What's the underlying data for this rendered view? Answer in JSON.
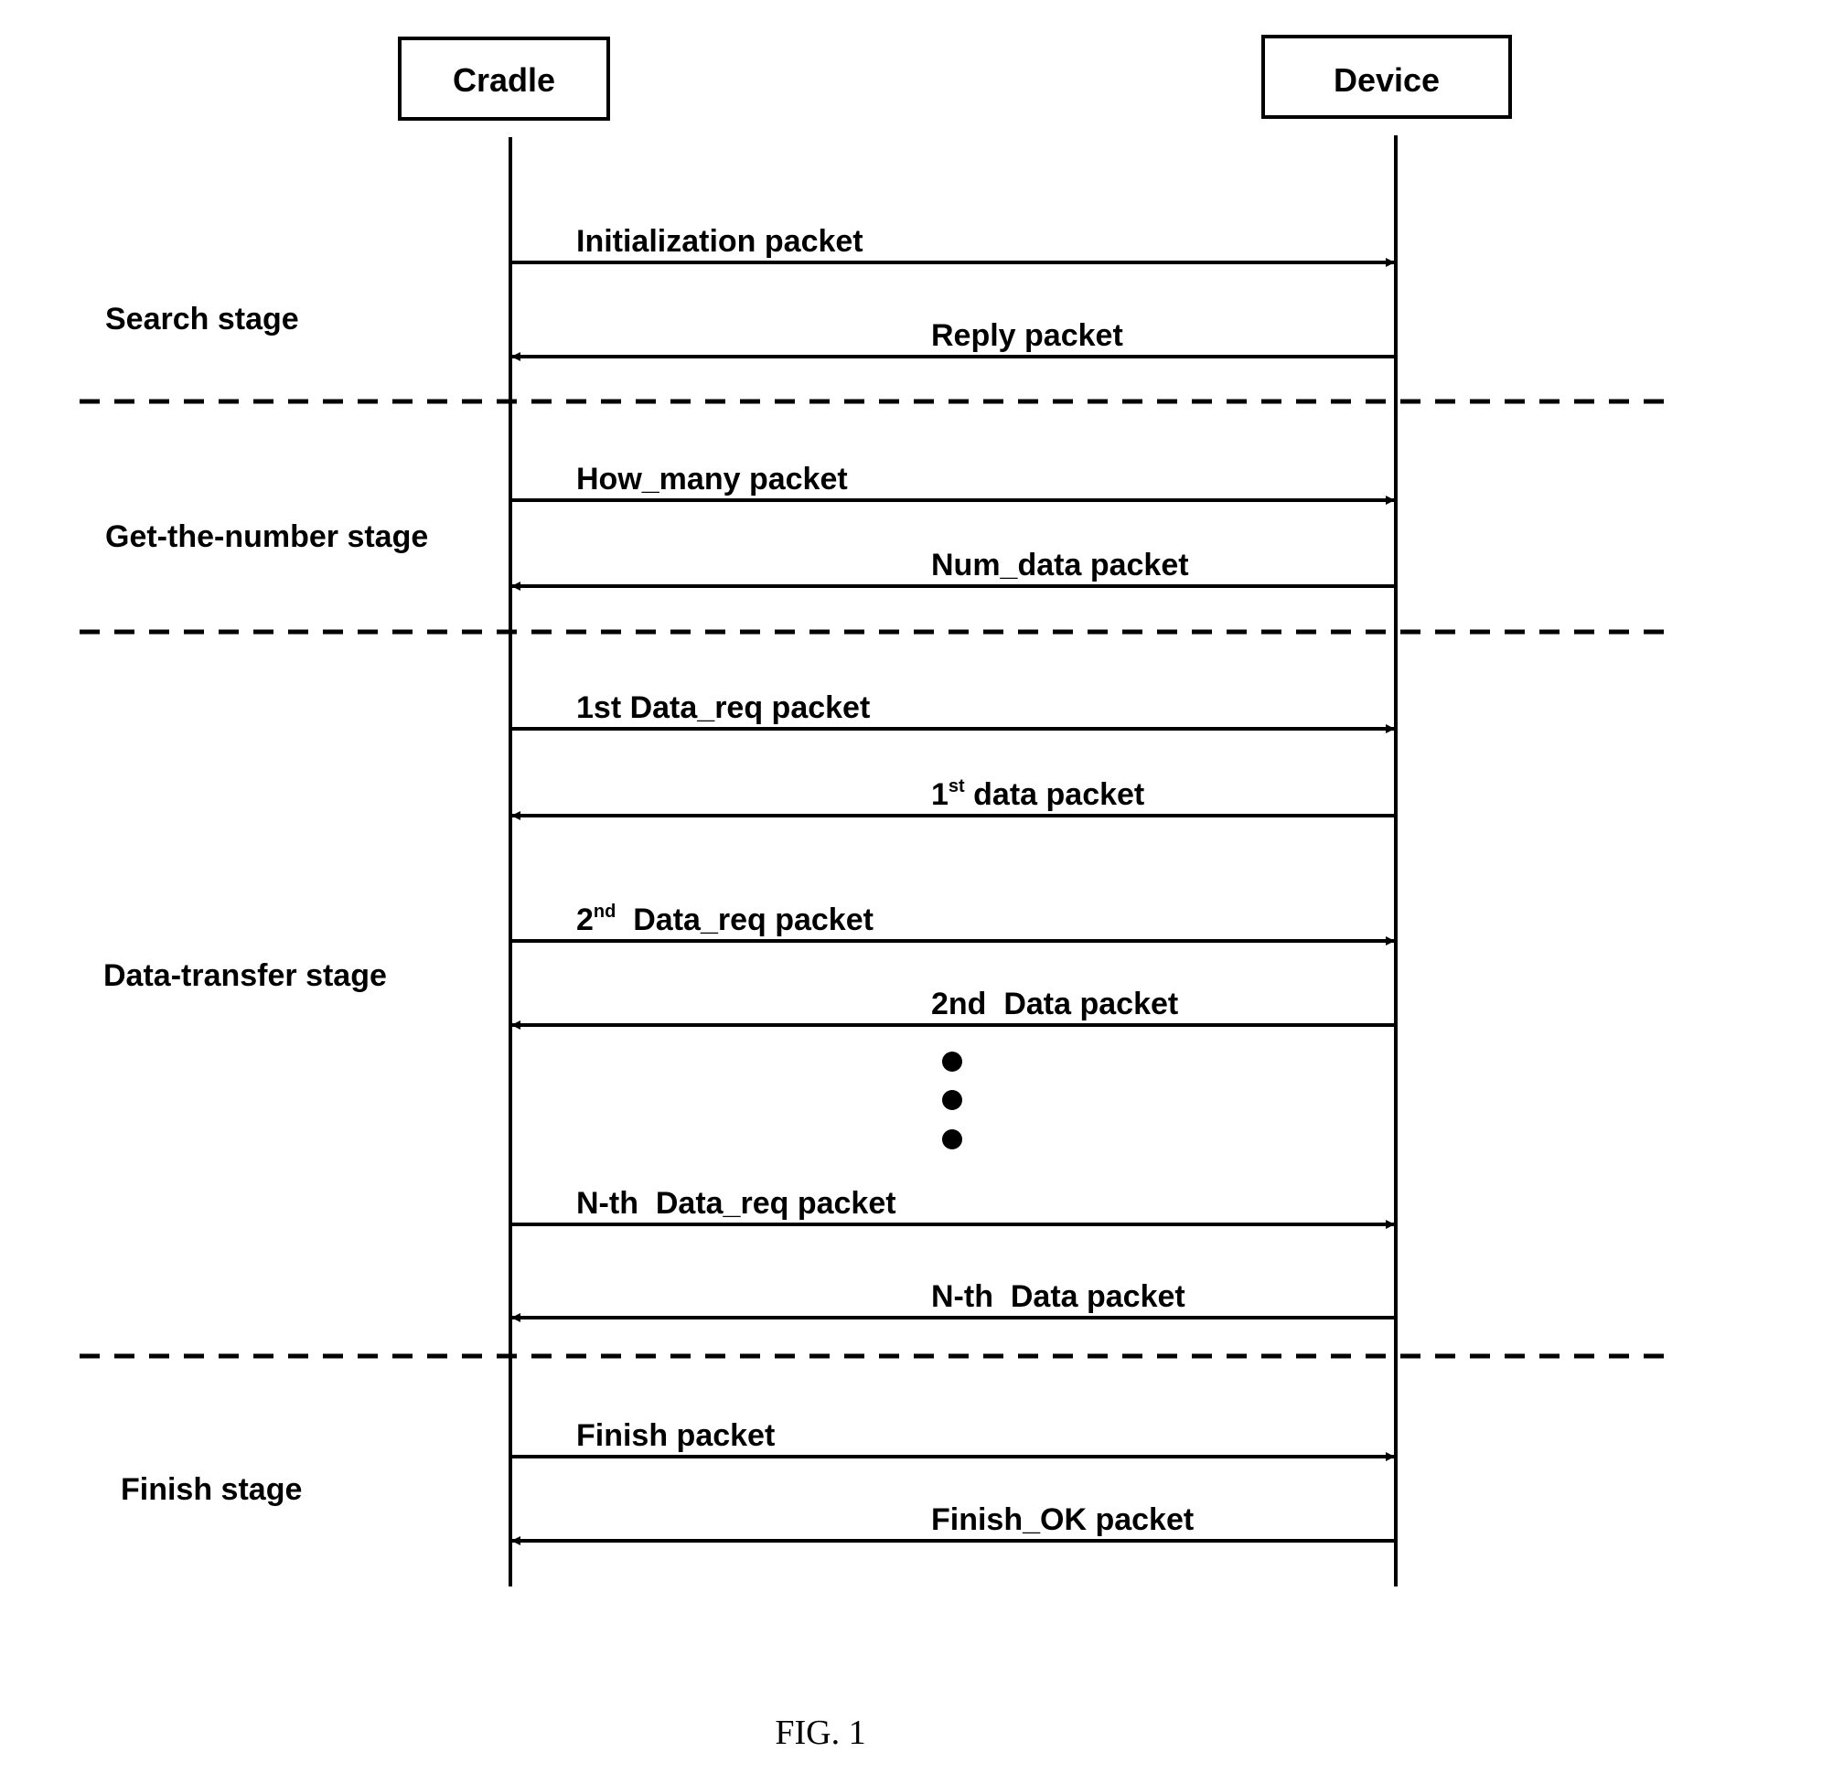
{
  "actors": {
    "cradle": {
      "label": "Cradle"
    },
    "device": {
      "label": "Device"
    }
  },
  "stages": [
    {
      "label": "Search stage"
    },
    {
      "label": "Get-the-number stage"
    },
    {
      "label": "Data-transfer stage"
    },
    {
      "label": "Finish stage"
    }
  ],
  "messages": [
    {
      "label": "Initialization packet",
      "sup": "",
      "rest": "",
      "from": "cradle",
      "to": "device",
      "stage": 0
    },
    {
      "label": "Reply packet",
      "sup": "",
      "rest": "",
      "from": "device",
      "to": "cradle",
      "stage": 0
    },
    {
      "label": "How_many packet",
      "sup": "",
      "rest": "",
      "from": "cradle",
      "to": "device",
      "stage": 1
    },
    {
      "label": "Num_data packet",
      "sup": "",
      "rest": "",
      "from": "device",
      "to": "cradle",
      "stage": 1
    },
    {
      "label": "1st Data_req packet",
      "sup": "",
      "rest": "",
      "from": "cradle",
      "to": "device",
      "stage": 2
    },
    {
      "label": "1",
      "sup": "st",
      "rest": " data packet",
      "from": "device",
      "to": "cradle",
      "stage": 2
    },
    {
      "label": "2",
      "sup": "nd",
      "rest": "  Data_req packet",
      "from": "cradle",
      "to": "device",
      "stage": 2
    },
    {
      "label": "2nd  Data packet",
      "sup": "",
      "rest": "",
      "from": "device",
      "to": "cradle",
      "stage": 2
    },
    {
      "label": "N-th  Data_req packet",
      "sup": "",
      "rest": "",
      "from": "cradle",
      "to": "device",
      "stage": 2
    },
    {
      "label": "N-th  Data packet",
      "sup": "",
      "rest": "",
      "from": "device",
      "to": "cradle",
      "stage": 2
    },
    {
      "label": "Finish packet",
      "sup": "",
      "rest": "",
      "from": "cradle",
      "to": "device",
      "stage": 3
    },
    {
      "label": "Finish_OK packet",
      "sup": "",
      "rest": "",
      "from": "device",
      "to": "cradle",
      "stage": 3
    }
  ],
  "ellipsis": {
    "count": 3,
    "meaning": "repeated data request/response pairs"
  },
  "caption": "FIG. 1"
}
